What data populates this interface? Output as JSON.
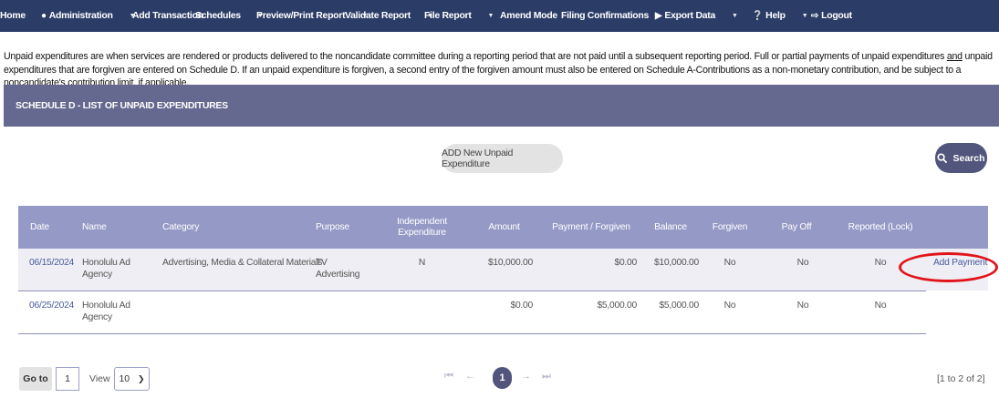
{
  "nav": {
    "home": "Home",
    "administration": "Administration",
    "add_transaction": "Add Transaction",
    "schedules": "Schedules",
    "preview_print": "Preview/Print Report",
    "validate": "Validate Report",
    "file_report": "File Report",
    "amend_mode": "Amend Mode",
    "filing_confirmations": "Filing Confirmations",
    "export_data": "Export Data",
    "help": "Help",
    "logout": "Logout"
  },
  "intro": {
    "part1": "Unpaid expenditures are when services are rendered or products delivered to the noncandidate committee during a reporting period that are not paid until a subsequent reporting period. Full or partial payments of unpaid expenditures ",
    "and": "and",
    "part2": " unpaid expenditures that are forgiven are entered on Schedule D. If an unpaid expenditure is forgiven, a second entry of the forgiven amount must also be entered on Schedule A-Contributions as a non-monetary contribution, and be subject to a noncandidate's contribution limit, if applicable."
  },
  "schedule_title": "SCHEDULE D - LIST OF UNPAID EXPENDITURES",
  "add_button": "ADD New Unpaid Expenditure",
  "search_button": "Search",
  "table": {
    "headers": {
      "date": "Date",
      "name": "Name",
      "category": "Category",
      "purpose": "Purpose",
      "independent": "Independent Expenditure",
      "amount": "Amount",
      "payment_forgiven": "Payment / Forgiven",
      "balance": "Balance",
      "forgiven": "Forgiven",
      "pay_off": "Pay Off",
      "reported": "Reported (Lock)"
    },
    "rows": [
      {
        "date": "06/15/2024",
        "name": "Honolulu Ad Agency",
        "category": "Advertising, Media & Collateral Materials",
        "purpose": "TV Advertising",
        "independent": "N",
        "amount": "$10,000.00",
        "payment_forgiven": "$0.00",
        "balance": "$10,000.00",
        "forgiven": "No",
        "pay_off": "No",
        "reported": "No",
        "action": "Add Payment"
      },
      {
        "date": "06/25/2024",
        "name": "Honolulu Ad Agency",
        "category": "",
        "purpose": "",
        "independent": "",
        "amount": "$0.00",
        "payment_forgiven": "$5,000.00",
        "balance": "$5,000.00",
        "forgiven": "No",
        "pay_off": "No",
        "reported": "No",
        "action": ""
      }
    ]
  },
  "pager": {
    "goto_label": "Go to",
    "goto_value": "1",
    "view_label": "View",
    "view_value": "10",
    "current_page": "1",
    "range": "[1 to 2 of 2]"
  },
  "colors": {
    "nav_bg": "#2b3d67",
    "header_bg": "#65688f",
    "table_header_bg": "#9599c6",
    "accent": "#52567c",
    "link": "#4b5c9c",
    "highlight": "#e2141b"
  }
}
